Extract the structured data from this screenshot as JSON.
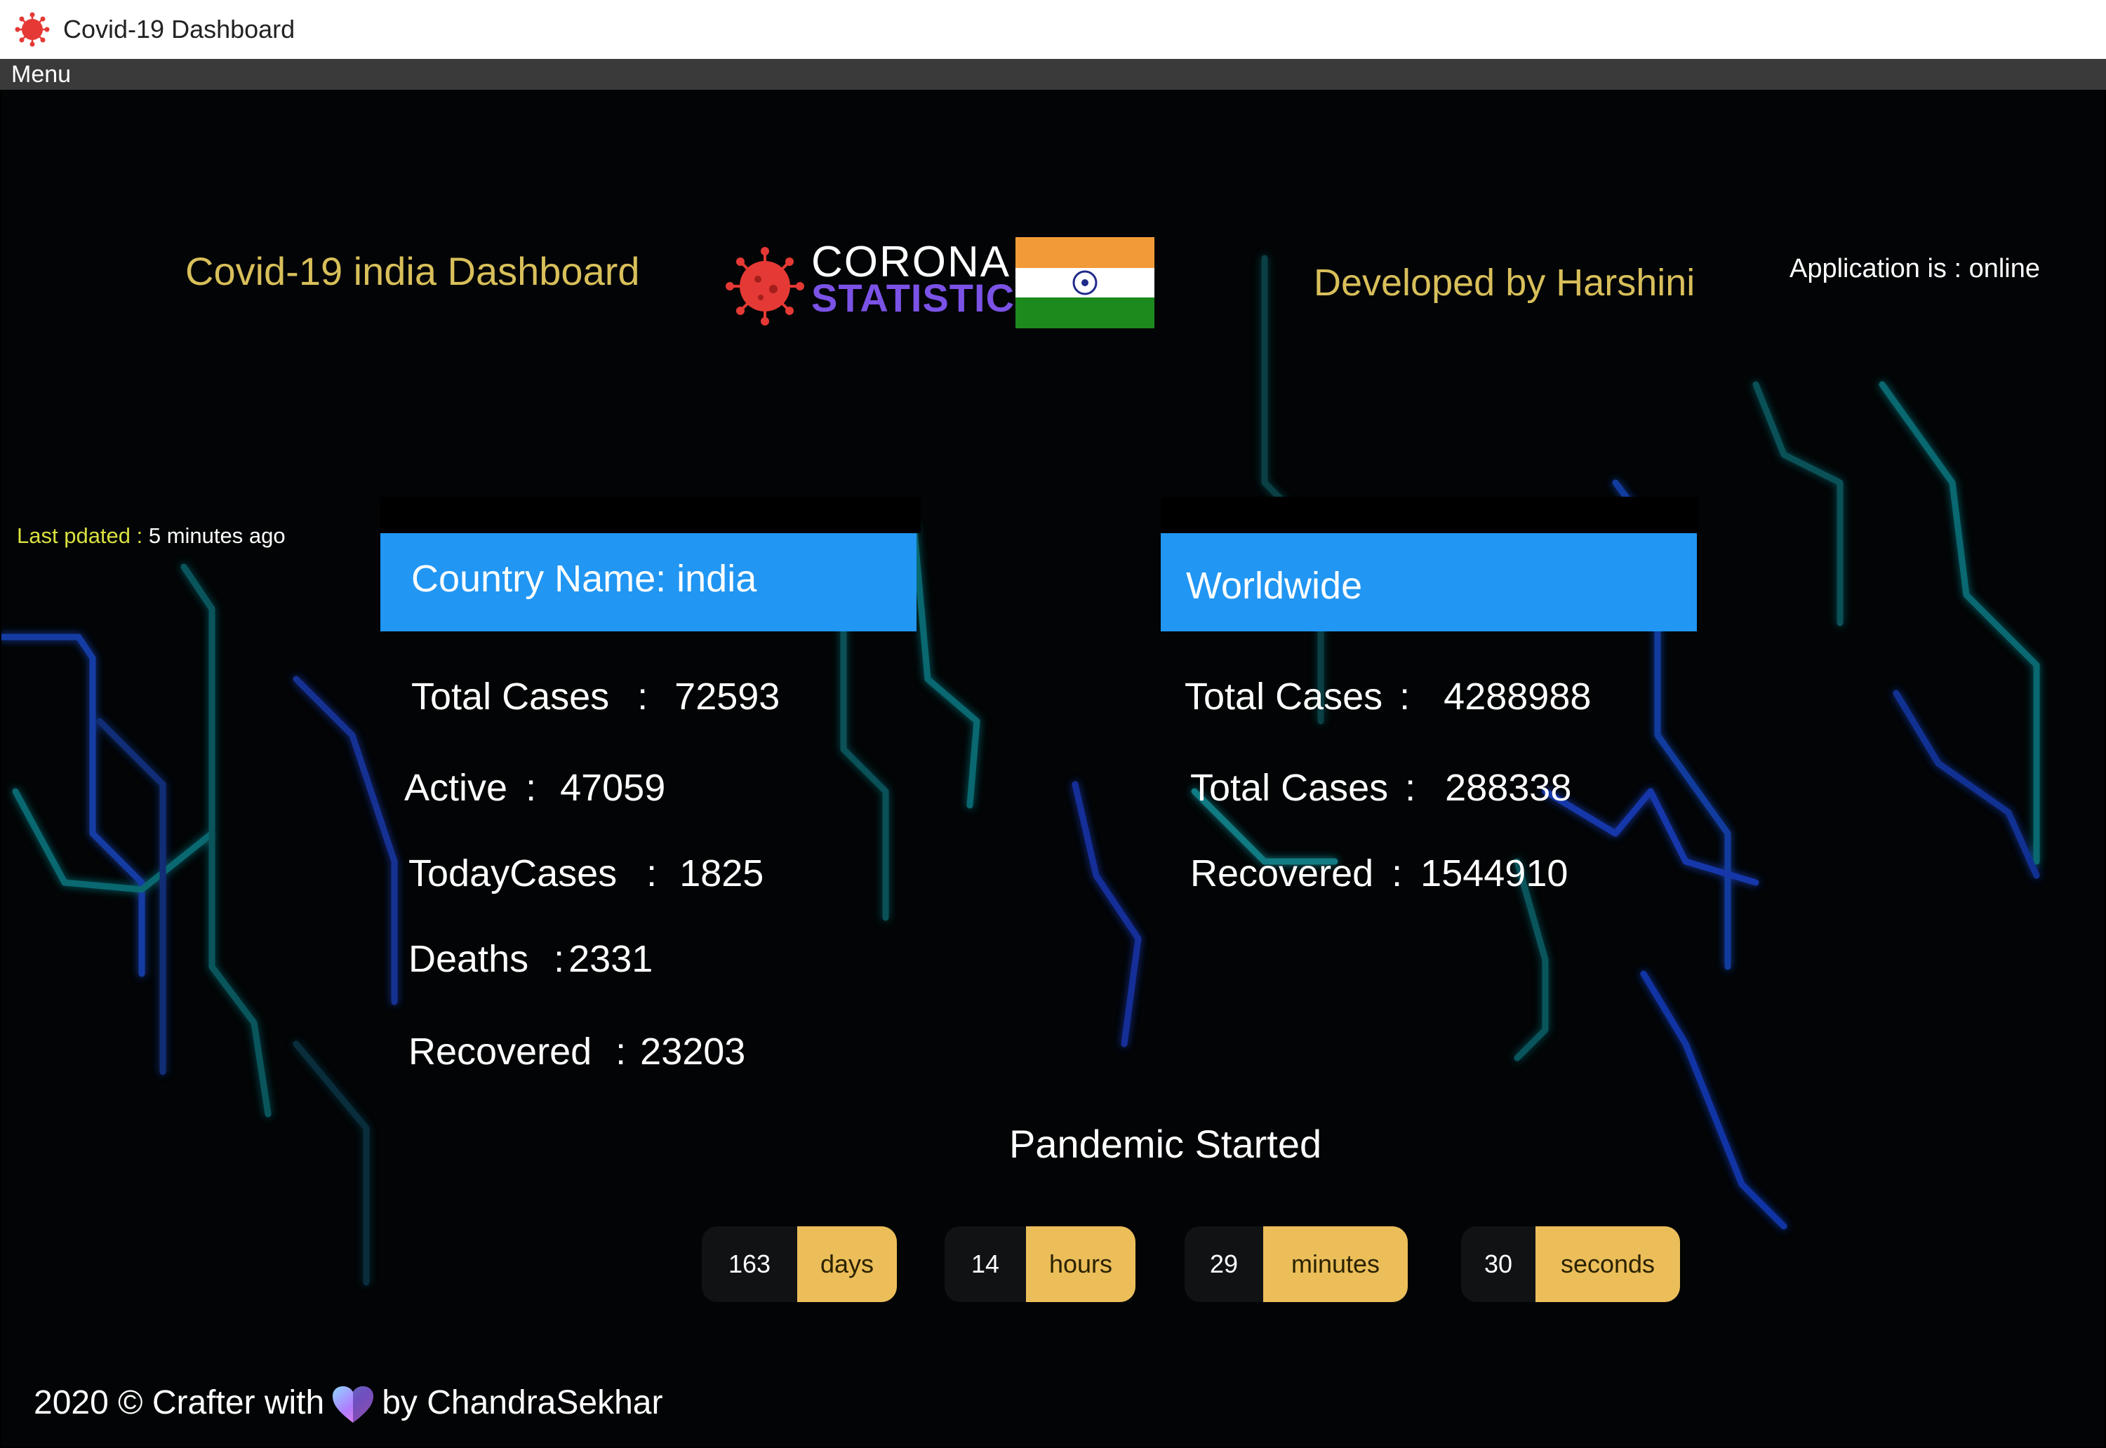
{
  "window": {
    "title": "Covid-19 Dashboard"
  },
  "menu": {
    "items": [
      "Menu"
    ]
  },
  "header": {
    "dashboard_title": "Covid-19 india Dashboard",
    "logo_line1": "CORONA",
    "logo_line2": "STATISTICS",
    "developer": "Developed by Harshini",
    "app_status": "Application is : online"
  },
  "last_updated": {
    "label": "Last pdated :",
    "value": " 5 minutes ago"
  },
  "country_panel": {
    "title": "Country Name: india",
    "stats": [
      {
        "label": "Total Cases",
        "sep": ":",
        "value": "72593"
      },
      {
        "label": "Active",
        "sep": ":",
        "value": "47059"
      },
      {
        "label": "TodayCases",
        "sep": ":",
        "value": "1825"
      },
      {
        "label": "Deaths",
        "sep": ":",
        "value": "2331"
      },
      {
        "label": "Recovered",
        "sep": ":",
        "value": "23203"
      }
    ]
  },
  "world_panel": {
    "title": "Worldwide",
    "stats": [
      {
        "label": "Total Cases",
        "sep": ":",
        "value": "4288988"
      },
      {
        "label": "Total Cases",
        "sep": ":",
        "value": "288338"
      },
      {
        "label": "Recovered",
        "sep": ":",
        "value": "1544910"
      }
    ]
  },
  "pandemic": {
    "title": "Pandemic  Started",
    "counters": [
      {
        "value": "163",
        "unit": "days"
      },
      {
        "value": "14",
        "unit": "hours"
      },
      {
        "value": "29",
        "unit": "minutes"
      },
      {
        "value": "30",
        "unit": "seconds"
      }
    ]
  },
  "footer": {
    "left": "2020 © Crafter with",
    "right": "by ChandraSekhar"
  },
  "colors": {
    "accent_blue": "#2196f3",
    "gold_text": "#d8bf5a",
    "counter_yellow": "#ebbe5a",
    "virus_red": "#e53935",
    "logo_purple": "#7b52e6"
  },
  "icons": {
    "title_icon": "virus-icon",
    "logo_icon": "virus-icon",
    "flag": "india-flag-icon",
    "footer_icon": "heart-icon"
  }
}
